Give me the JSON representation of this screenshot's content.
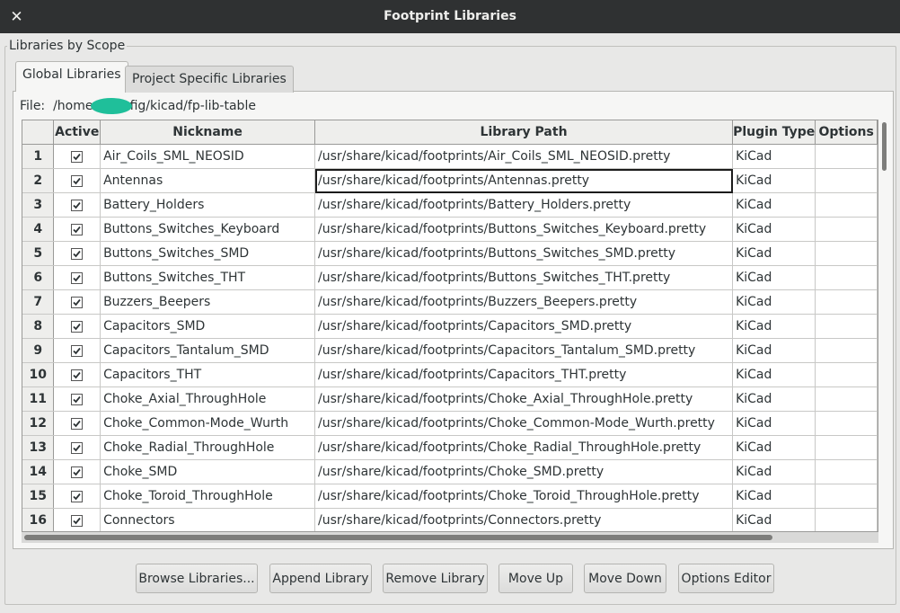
{
  "window": {
    "title": "Footprint Libraries",
    "close_glyph": "✕"
  },
  "group": {
    "label": "Libraries by Scope"
  },
  "tabs": [
    {
      "label": "Global Libraries",
      "active": true
    },
    {
      "label": "Project Specific Libraries",
      "active": false
    }
  ],
  "file": {
    "label": "File:",
    "path_start": "/home",
    "path_end": "config/kicad/fp-lib-table"
  },
  "table": {
    "columns": [
      "Active",
      "Nickname",
      "Library Path",
      "Plugin Type",
      "Options"
    ],
    "rows": [
      {
        "num": "1",
        "active": true,
        "nickname": "Air_Coils_SML_NEOSID",
        "path": "/usr/share/kicad/footprints/Air_Coils_SML_NEOSID.pretty",
        "plugin": "KiCad",
        "options": ""
      },
      {
        "num": "2",
        "active": true,
        "nickname": "Antennas",
        "path": "/usr/share/kicad/footprints/Antennas.pretty",
        "plugin": "KiCad",
        "options": ""
      },
      {
        "num": "3",
        "active": true,
        "nickname": "Battery_Holders",
        "path": "/usr/share/kicad/footprints/Battery_Holders.pretty",
        "plugin": "KiCad",
        "options": ""
      },
      {
        "num": "4",
        "active": true,
        "nickname": "Buttons_Switches_Keyboard",
        "path": "/usr/share/kicad/footprints/Buttons_Switches_Keyboard.pretty",
        "plugin": "KiCad",
        "options": ""
      },
      {
        "num": "5",
        "active": true,
        "nickname": "Buttons_Switches_SMD",
        "path": "/usr/share/kicad/footprints/Buttons_Switches_SMD.pretty",
        "plugin": "KiCad",
        "options": ""
      },
      {
        "num": "6",
        "active": true,
        "nickname": "Buttons_Switches_THT",
        "path": "/usr/share/kicad/footprints/Buttons_Switches_THT.pretty",
        "plugin": "KiCad",
        "options": ""
      },
      {
        "num": "7",
        "active": true,
        "nickname": "Buzzers_Beepers",
        "path": "/usr/share/kicad/footprints/Buzzers_Beepers.pretty",
        "plugin": "KiCad",
        "options": ""
      },
      {
        "num": "8",
        "active": true,
        "nickname": "Capacitors_SMD",
        "path": "/usr/share/kicad/footprints/Capacitors_SMD.pretty",
        "plugin": "KiCad",
        "options": ""
      },
      {
        "num": "9",
        "active": true,
        "nickname": "Capacitors_Tantalum_SMD",
        "path": "/usr/share/kicad/footprints/Capacitors_Tantalum_SMD.pretty",
        "plugin": "KiCad",
        "options": ""
      },
      {
        "num": "10",
        "active": true,
        "nickname": "Capacitors_THT",
        "path": "/usr/share/kicad/footprints/Capacitors_THT.pretty",
        "plugin": "KiCad",
        "options": ""
      },
      {
        "num": "11",
        "active": true,
        "nickname": "Choke_Axial_ThroughHole",
        "path": "/usr/share/kicad/footprints/Choke_Axial_ThroughHole.pretty",
        "plugin": "KiCad",
        "options": ""
      },
      {
        "num": "12",
        "active": true,
        "nickname": "Choke_Common-Mode_Wurth",
        "path": "/usr/share/kicad/footprints/Choke_Common-Mode_Wurth.pretty",
        "plugin": "KiCad",
        "options": ""
      },
      {
        "num": "13",
        "active": true,
        "nickname": "Choke_Radial_ThroughHole",
        "path": "/usr/share/kicad/footprints/Choke_Radial_ThroughHole.pretty",
        "plugin": "KiCad",
        "options": ""
      },
      {
        "num": "14",
        "active": true,
        "nickname": "Choke_SMD",
        "path": "/usr/share/kicad/footprints/Choke_SMD.pretty",
        "plugin": "KiCad",
        "options": ""
      },
      {
        "num": "15",
        "active": true,
        "nickname": "Choke_Toroid_ThroughHole",
        "path": "/usr/share/kicad/footprints/Choke_Toroid_ThroughHole.pretty",
        "plugin": "KiCad",
        "options": ""
      },
      {
        "num": "16",
        "active": true,
        "nickname": "Connectors",
        "path": "/usr/share/kicad/footprints/Connectors.pretty",
        "plugin": "KiCad",
        "options": ""
      }
    ]
  },
  "buttons": {
    "browse": "Browse Libraries...",
    "append": "Append Library",
    "remove": "Remove Library",
    "move_up": "Move Up",
    "move_down": "Move Down",
    "options_editor": "Options Editor"
  },
  "colors": {
    "titlebar": "#2f3132",
    "redaction": "#1fbf9a",
    "selection_border": "#1c1c1c"
  },
  "icons": {
    "close": "close-icon",
    "checkbox": "checkbox-checked-icon"
  }
}
